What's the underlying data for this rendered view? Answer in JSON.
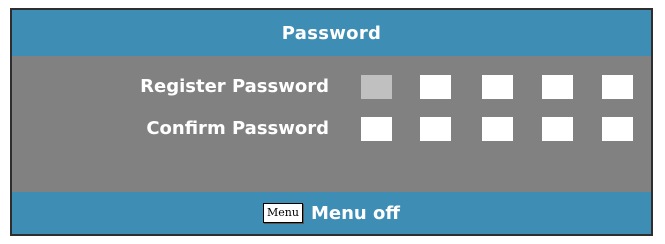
{
  "dialog": {
    "title": "Password",
    "colors": {
      "header_bar": "#3e8db5",
      "panel": "#818181",
      "field_empty": "#ffffff",
      "field_active": "#c0c0c0",
      "text": "#ffffff"
    }
  },
  "rows": [
    {
      "label": "Register Password",
      "active_digit_index": 0,
      "digit_count": 5
    },
    {
      "label": "Confirm Password",
      "active_digit_index": null,
      "digit_count": 5
    }
  ],
  "footer": {
    "key_label": "Menu",
    "action_label": "Menu off"
  }
}
